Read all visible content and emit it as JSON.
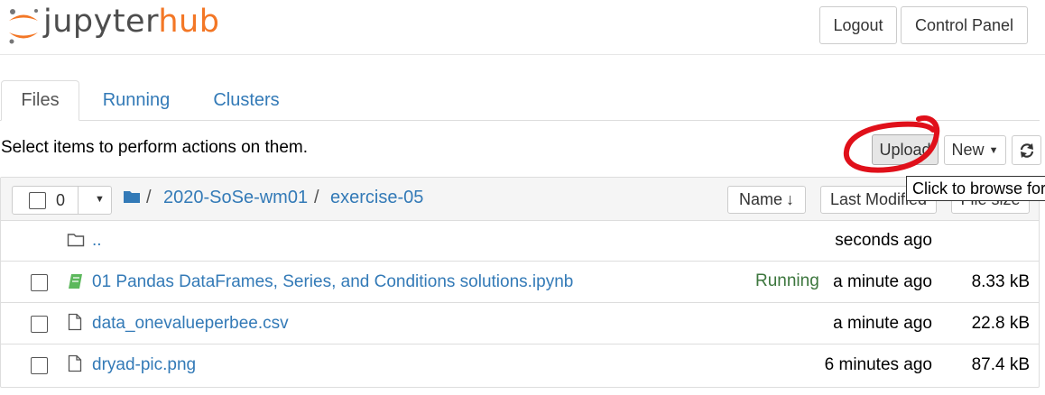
{
  "header": {
    "logo_jupyter": "jupyter",
    "logo_hub": "hub",
    "logout_label": "Logout",
    "control_panel_label": "Control Panel"
  },
  "tabs": [
    {
      "label": "Files",
      "active": true
    },
    {
      "label": "Running",
      "active": false
    },
    {
      "label": "Clusters",
      "active": false
    }
  ],
  "toolbar": {
    "hint": "Select items to perform actions on them.",
    "upload_label": "Upload",
    "new_label": "New",
    "tooltip": "Click to browse for"
  },
  "list_header": {
    "selected_count": "0",
    "breadcrumb": [
      "/",
      "2020-SoSe-wm01",
      "/",
      "exercise-05"
    ],
    "sort_name": "Name",
    "sort_modified": "Last Modified",
    "sort_size": "File size"
  },
  "rows": [
    {
      "name": "..",
      "modified": "seconds ago",
      "size": "",
      "status": "",
      "icon": "folder-icon"
    },
    {
      "name": "01 Pandas DataFrames, Series, and Conditions solutions.ipynb",
      "modified": "a minute ago",
      "size": "8.33 kB",
      "status": "Running",
      "icon": "notebook-icon"
    },
    {
      "name": "data_onevalueperbee.csv",
      "modified": "a minute ago",
      "size": "22.8 kB",
      "status": "",
      "icon": "file-icon"
    },
    {
      "name": "dryad-pic.png",
      "modified": "6 minutes ago",
      "size": "87.4 kB",
      "status": "",
      "icon": "file-icon"
    }
  ],
  "colors": {
    "accent": "#337ab7",
    "brand_orange": "#f37726",
    "running": "#3c763d",
    "annotation": "#e0101a"
  }
}
